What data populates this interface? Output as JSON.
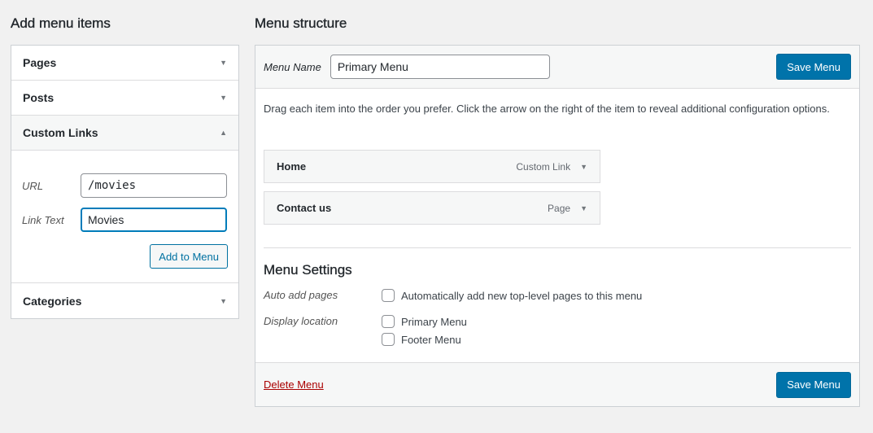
{
  "left": {
    "heading": "Add menu items",
    "sections": {
      "pages": "Pages",
      "posts": "Posts",
      "custom_links": "Custom Links",
      "categories": "Categories"
    },
    "custom_links": {
      "url_label": "URL",
      "url_value": "/movies",
      "link_text_label": "Link Text",
      "link_text_value": "Movies",
      "add_button": "Add to Menu"
    },
    "icons": {
      "collapsed": "▼",
      "expanded": "▲"
    }
  },
  "right": {
    "heading": "Menu structure",
    "menu_name_label": "Menu Name",
    "menu_name_value": "Primary Menu",
    "save_button": "Save Menu",
    "instructions": "Drag each item into the order you prefer. Click the arrow on the right of the item to reveal additional configuration options.",
    "items": [
      {
        "title": "Home",
        "type": "Custom Link"
      },
      {
        "title": "Contact us",
        "type": "Page"
      }
    ],
    "settings": {
      "title": "Menu Settings",
      "auto_add_label": "Auto add pages",
      "auto_add_option": "Automatically add new top-level pages to this menu",
      "display_location_label": "Display location",
      "locations": [
        "Primary Menu",
        "Footer Menu"
      ]
    },
    "delete_link": "Delete Menu",
    "colors": {
      "primary": "#0073aa",
      "danger": "#a00"
    }
  }
}
